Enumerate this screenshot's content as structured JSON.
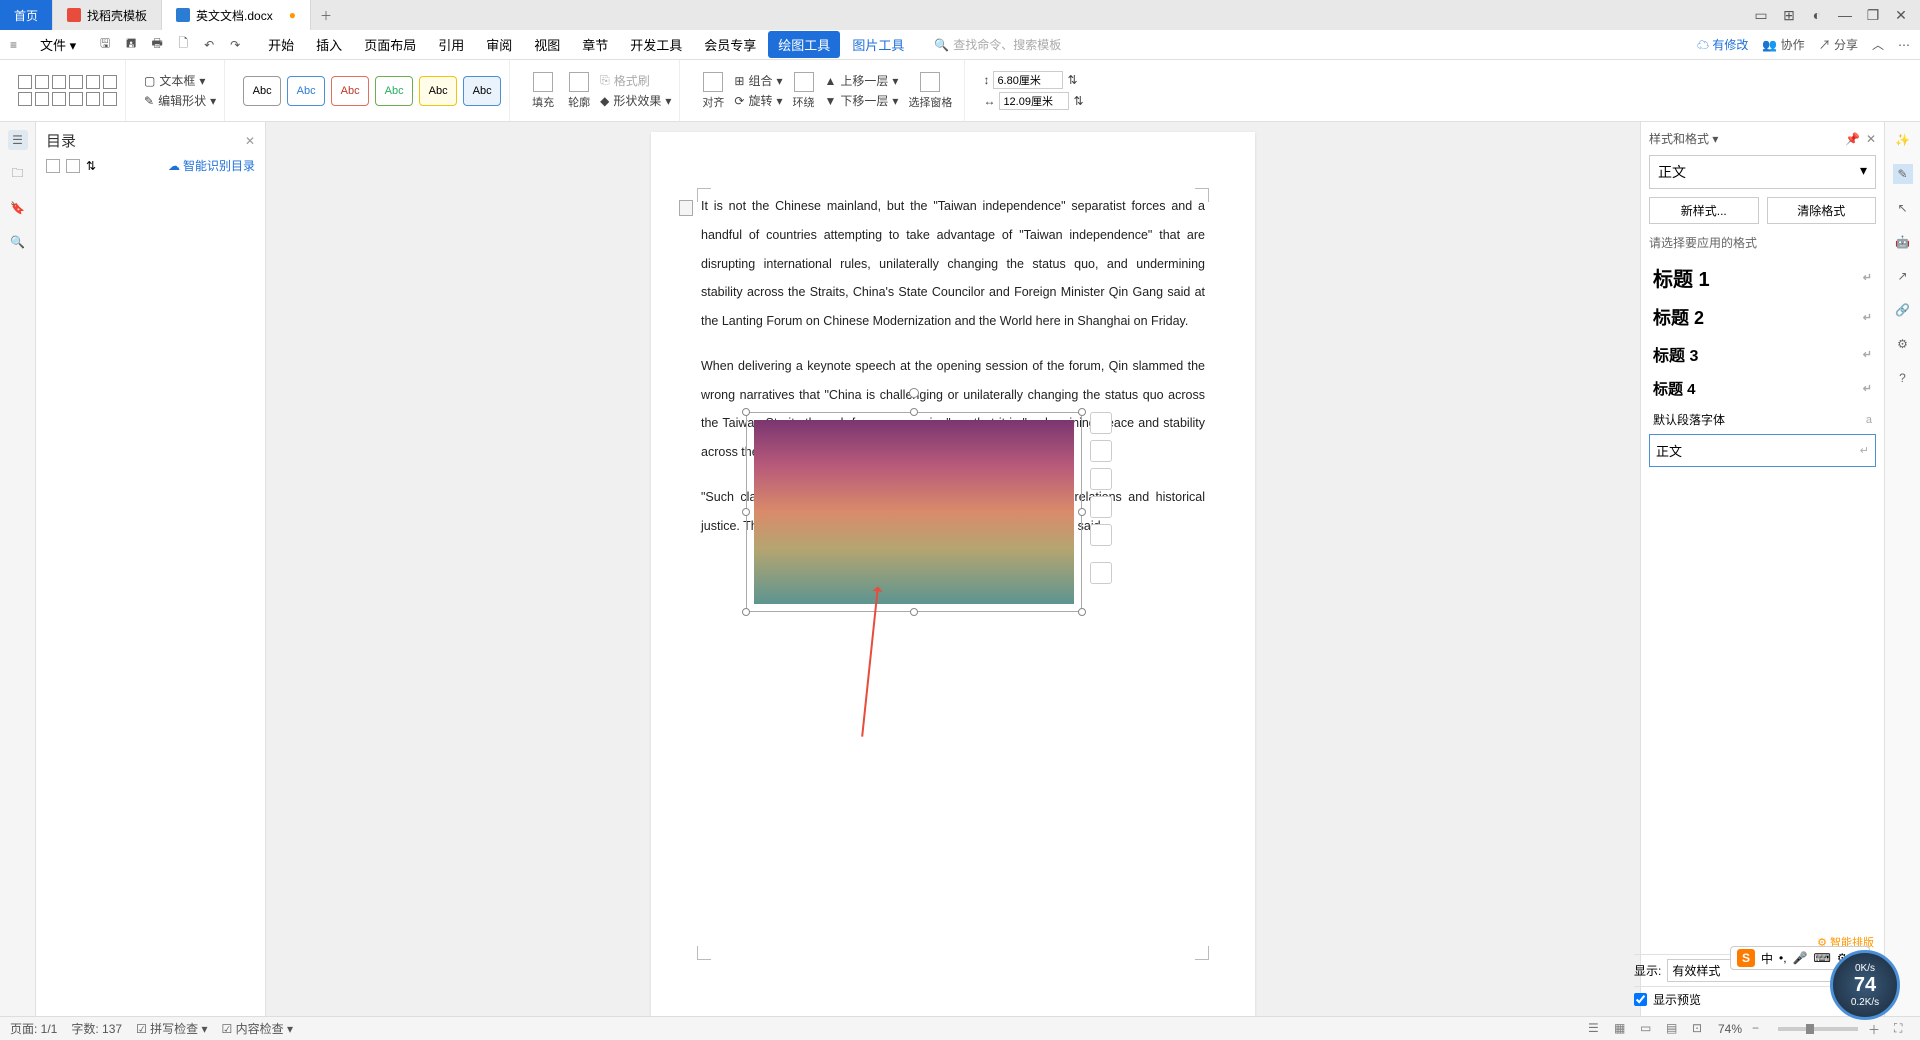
{
  "titlebar": {
    "home_tab": "首页",
    "template_tab": "找稻壳模板",
    "doc_tab": "英文文档.docx"
  },
  "menubar": {
    "file": "文件",
    "tabs": [
      "开始",
      "插入",
      "页面布局",
      "引用",
      "审阅",
      "视图",
      "章节",
      "开发工具",
      "会员专享"
    ],
    "draw_tools": "绘图工具",
    "pic_tools": "图片工具",
    "search_ph": "查找命令、搜索模板",
    "has_changes": "有修改",
    "collab": "协作",
    "share": "分享"
  },
  "ribbon": {
    "textbox": "文本框",
    "edit_shape": "编辑形状",
    "abc": "Abc",
    "fill": "填充",
    "outline": "轮廓",
    "shape_fx": "形状效果",
    "format_painter": "格式刷",
    "align": "对齐",
    "group": "组合",
    "rotate": "旋转",
    "wrap": "环绕",
    "bring_fwd": "上移一层",
    "send_back": "下移一层",
    "sel_pane": "选择窗格",
    "width": "6.80厘米",
    "height": "12.09厘米"
  },
  "toc": {
    "title": "目录",
    "smart": "智能识别目录"
  },
  "doc": {
    "p1": "It is not the Chinese mainland, but the \"Taiwan independence\" separatist forces and a handful of countries attempting to take advantage of \"Taiwan independence\" that are disrupting international rules, unilaterally changing the status quo, and undermining stability across the Straits, China's State Councilor and Foreign Minister Qin Gang said at the Lanting Forum on Chinese Modernization and the World here in Shanghai on Friday.",
    "p2": "When delivering a keynote speech at the opening session of the forum, Qin slammed the wrong narratives that \"China is challenging or unilaterally changing the status quo across the Taiwan Straits through force or coercion\", or that it is \"undermining peace and stability across the Straits\".",
    "p3": "\"Such claims go against basic common sense on international relations and historical justice. The logic is absurd, and the consequences dangerous,\" Qin said."
  },
  "styles": {
    "panel_title": "样式和格式",
    "current": "正文",
    "new_style": "新样式...",
    "clear_fmt": "清除格式",
    "hint": "请选择要应用的格式",
    "h1": "标题 1",
    "h2": "标题 2",
    "h3": "标题 3",
    "h4": "标题 4",
    "default_font": "默认段落字体",
    "body": "正文",
    "show": "显示:",
    "show_val": "有效样式",
    "preview": "显示预览",
    "smart_layout": "智能排版"
  },
  "statusbar": {
    "page": "页面: 1/1",
    "words": "字数: 137",
    "spell": "拼写检查",
    "content": "内容检查",
    "zoom": "74%"
  },
  "ime": {
    "logo": "S",
    "lang": "中"
  },
  "netwidget": {
    "up": "0K/s",
    "down": "0.2K/s",
    "val": "74"
  }
}
